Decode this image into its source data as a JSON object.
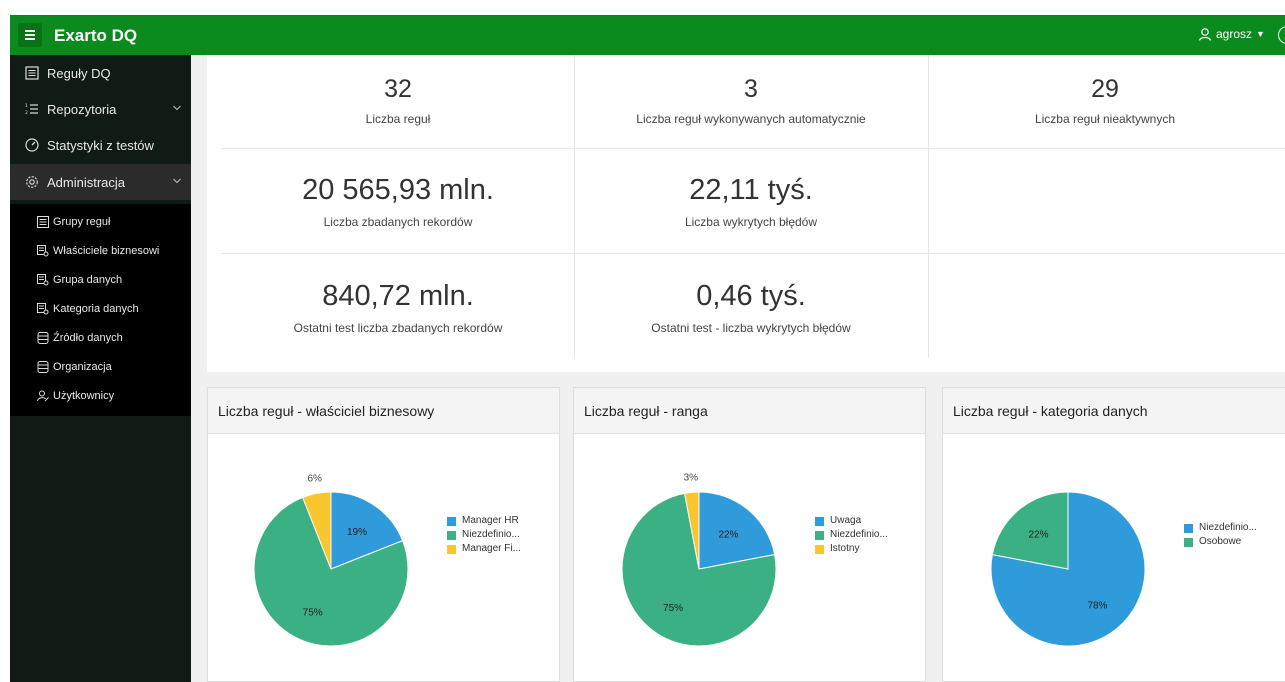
{
  "header": {
    "app_title": "Exarto DQ",
    "user_name": "agrosz",
    "user_caret": "▼"
  },
  "sidebar": {
    "items": [
      {
        "label": "Reguły DQ",
        "icon": "list-icon"
      },
      {
        "label": "Repozytoria",
        "icon": "numbered-list-icon",
        "expandable": true
      },
      {
        "label": "Statystyki z testów",
        "icon": "gauge-icon"
      },
      {
        "label": "Administracja",
        "icon": "gear-icon",
        "expandable": true,
        "active": true
      }
    ],
    "sub_items": [
      {
        "label": "Grupy reguł",
        "icon": "list-icon"
      },
      {
        "label": "Właściciele biznesowi",
        "icon": "table-search-icon"
      },
      {
        "label": "Grupa danych",
        "icon": "table-search-icon"
      },
      {
        "label": "Kategoria danych",
        "icon": "table-search-icon"
      },
      {
        "label": "Źródło danych",
        "icon": "database-icon"
      },
      {
        "label": "Organizacja",
        "icon": "database-icon"
      },
      {
        "label": "Użytkownicy",
        "icon": "user-key-icon"
      }
    ]
  },
  "stats": {
    "rules_count": "32",
    "rules_count_label": "Liczba reguł",
    "auto_rules": "3",
    "auto_rules_label": "Liczba reguł wykonywanych automatycznie",
    "inactive_rules": "29",
    "inactive_rules_label": "Liczba reguł nieaktywnych",
    "records": "20 565,93 mln.",
    "records_label": "Liczba zbadanych rekordów",
    "errors": "22,11 tyś.",
    "errors_label": "Liczba wykrytych błędów",
    "last_records": "840,72 mln.",
    "last_records_label": "Ostatni test liczba zbadanych rekordów",
    "last_errors": "0,46 tyś.",
    "last_errors_label": "Ostatni test - liczba wykrytych błędów"
  },
  "colors": {
    "header_green": "#0b8a1e",
    "blue": "#2f9bdb",
    "green": "#3bb084",
    "yellow": "#f9c62f"
  },
  "chart_data": [
    {
      "type": "pie",
      "title": "Liczba reguł - właściciel biznesowy",
      "categories": [
        "Manager HR",
        "Niezdefinio...",
        "Manager Fi..."
      ],
      "values": [
        19,
        75,
        6
      ],
      "labels": [
        "19%",
        "75%",
        "6%"
      ],
      "colors": [
        "#2f9bdb",
        "#3bb084",
        "#f9c62f"
      ]
    },
    {
      "type": "pie",
      "title": "Liczba reguł - ranga",
      "categories": [
        "Uwaga",
        "Niezdefinio...",
        "Istotny"
      ],
      "values": [
        22,
        75,
        3
      ],
      "labels": [
        "22%",
        "75%",
        "3%"
      ],
      "colors": [
        "#2f9bdb",
        "#3bb084",
        "#f9c62f"
      ]
    },
    {
      "type": "pie",
      "title": "Liczba reguł - kategoria danych",
      "categories": [
        "Niezdefinio...",
        "Osobowe"
      ],
      "values": [
        78,
        22
      ],
      "labels": [
        "78%",
        "22%"
      ],
      "colors": [
        "#2f9bdb",
        "#3bb084"
      ]
    }
  ]
}
